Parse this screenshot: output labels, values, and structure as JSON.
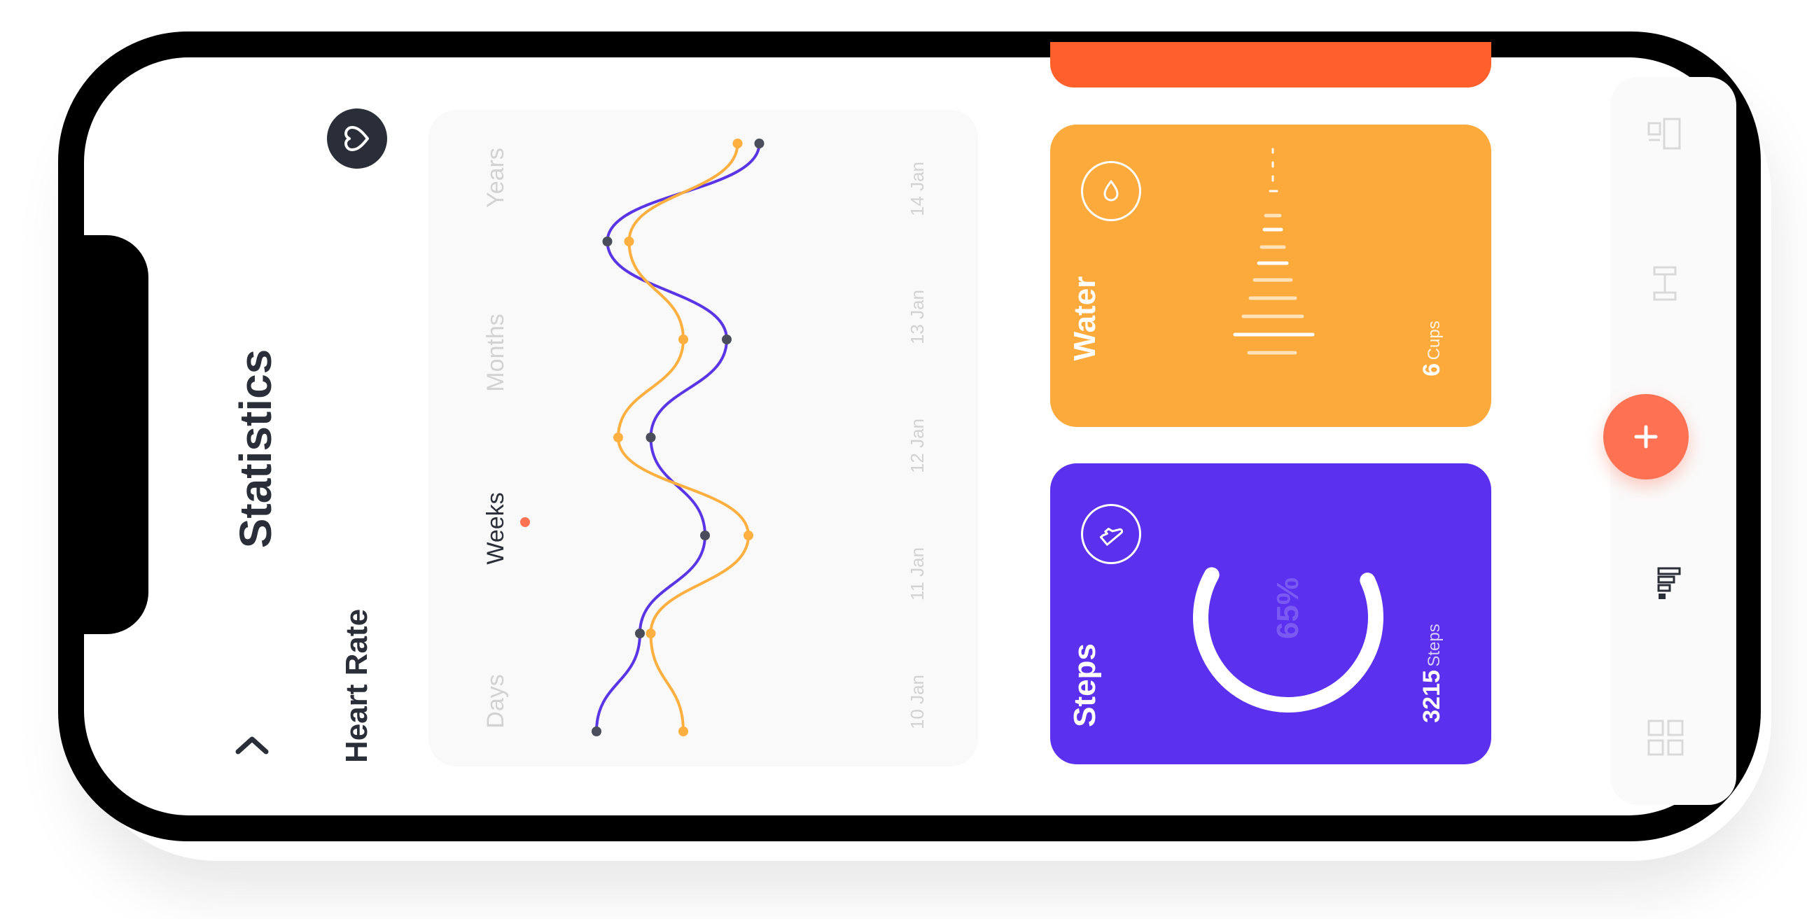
{
  "page": {
    "title": "Statistics",
    "subtitle": "Heart Rate"
  },
  "periods": [
    {
      "label": "Days",
      "active": false
    },
    {
      "label": "Weeks",
      "active": true
    },
    {
      "label": "Months",
      "active": false
    },
    {
      "label": "Years",
      "active": false
    }
  ],
  "chart_data": {
    "type": "line",
    "x": [
      "10 Jan",
      "11 Jan",
      "12 Jan",
      "13 Jan",
      "14 Jan"
    ],
    "series": [
      {
        "color": "#5a35e6",
        "values": [
          20,
          40,
          70,
          45,
          80,
          25,
          95
        ]
      },
      {
        "color": "#fdaf40",
        "values": [
          60,
          45,
          90,
          30,
          60,
          35,
          85
        ]
      }
    ]
  },
  "cards": {
    "water": {
      "title": "Water",
      "value": "6",
      "unit": "Cups",
      "level": 0.6
    },
    "steps": {
      "title": "Steps",
      "value": "3215",
      "unit": "Steps",
      "percent": "65%",
      "progress": 0.65
    }
  },
  "colors": {
    "accent": "#fe7153",
    "purple": "#5b30ee",
    "orange": "#fdaa3c",
    "top_card": "#ff5f2b",
    "dark": "#2a2e38"
  },
  "icons": [
    "chevron-left-icon",
    "heart-icon",
    "drop-icon",
    "shoe-icon",
    "plus-icon",
    "dumbbell-icon",
    "bar-chart-icon",
    "grid-icon",
    "profile-icon"
  ]
}
